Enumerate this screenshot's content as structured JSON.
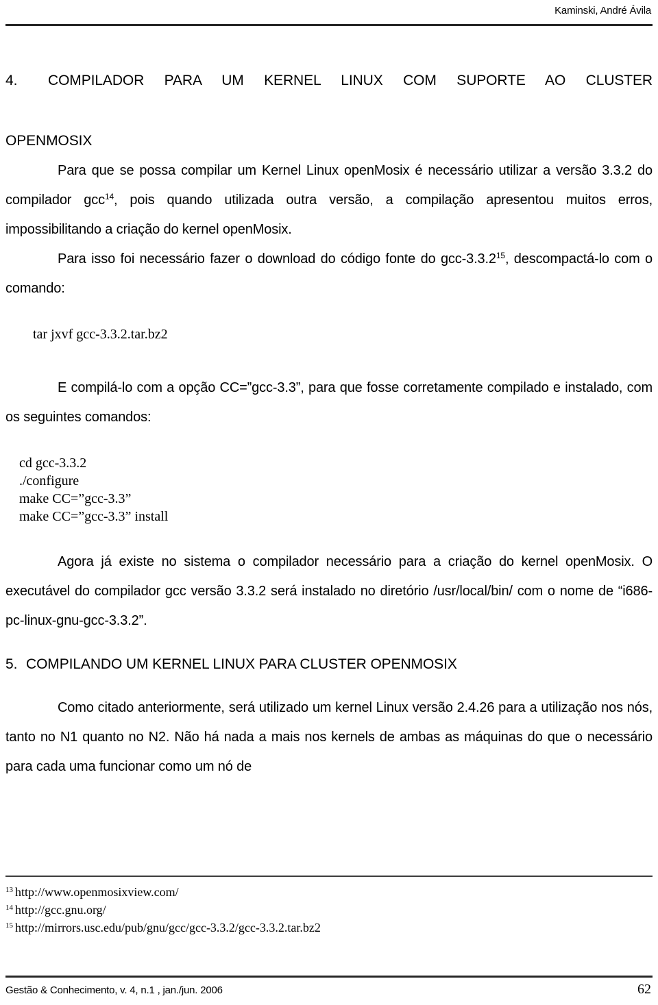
{
  "header": {
    "author": "Kaminski, André Ávila"
  },
  "sections": {
    "section4": {
      "number": "4.",
      "title_line1": "COMPILADOR PARA UM KERNEL LINUX COM SUPORTE AO CLUSTER",
      "title_line2": "OPENMOSIX"
    },
    "section5": {
      "number": "5.",
      "title": "COMPILANDO UM KERNEL LINUX PARA CLUSTER OPENMOSIX"
    }
  },
  "paragraphs": {
    "p1_part1": "Para que se possa compilar um Kernel Linux openMosix é necessário utilizar a versão 3.3.2 do compilador gcc",
    "p1_sup": "14",
    "p1_part2": ", pois quando utilizada outra versão, a compilação apresentou muitos erros, impossibilitando a criação do kernel openMosix.",
    "p2_part1": "Para isso foi necessário fazer o download do código fonte do gcc-3.3.2",
    "p2_sup": "15",
    "p2_part2": ", descompactá-lo com o comando:",
    "p3": "E compilá-lo com a opção CC=”gcc-3.3”, para que fosse corretamente compilado e instalado, com os seguintes comandos:",
    "p4": "Agora já existe no sistema o compilador necessário para a criação do kernel openMosix. O executável do compilador gcc versão 3.3.2 será instalado no diretório /usr/local/bin/ com o nome de “i686-pc-linux-gnu-gcc-3.3.2”.",
    "p5": "Como citado anteriormente, será utilizado um kernel Linux versão 2.4.26 para a utilização nos nós, tanto no N1 quanto no N2. Não há nada a mais nos kernels de ambas as máquinas do que o necessário para cada uma funcionar como um nó de"
  },
  "code_blocks": {
    "block1": "        tar jxvf gcc-3.3.2.tar.bz2",
    "block2": "    cd gcc-3.3.2\n    ./configure\n    make CC=”gcc-3.3”\n    make CC=”gcc-3.3” install"
  },
  "footnotes": [
    {
      "marker": "13",
      "text": "http://www.openmosixview.com/"
    },
    {
      "marker": "14",
      "text": "http://gcc.gnu.org/"
    },
    {
      "marker": "15",
      "text": "http://mirrors.usc.edu/pub/gnu/gcc/gcc-3.3.2/gcc-3.3.2.tar.bz2"
    }
  ],
  "footer": {
    "citation": "Gestão & Conhecimento, v. 4, n.1 , jan./jun. 2006",
    "page_number": "62"
  }
}
